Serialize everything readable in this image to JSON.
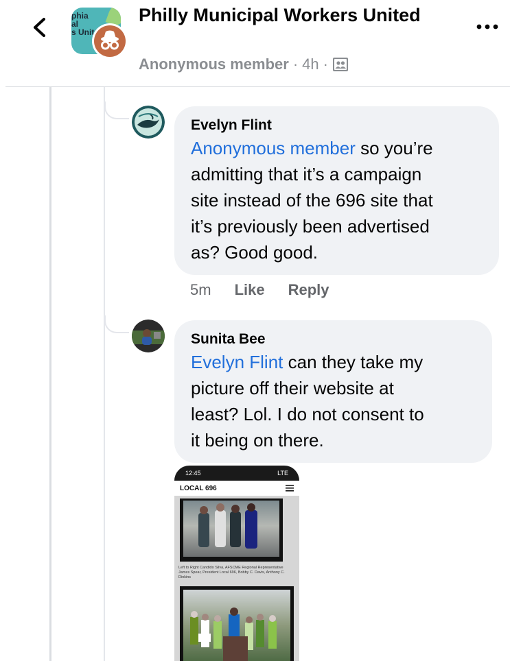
{
  "header": {
    "group_name": "Philly Municipal Workers United",
    "group_avatar_text": "phia\nal\ns Unit",
    "author_label": "Anonymous member",
    "separator": "·",
    "time": "4h",
    "audience_icon": "group-members-icon",
    "more_icon": "more-dots-icon",
    "back_icon": "back-chevron-icon"
  },
  "comments": [
    {
      "author": "Evelyn Flint",
      "mention": "Anonymous member",
      "lines": [
        " so you’re",
        "admitting that it’s a campaign",
        "site instead of the 696 site that",
        "it’s previously been advertised",
        "as? Good good."
      ],
      "time": "5m",
      "like_label": "Like",
      "reply_label": "Reply"
    },
    {
      "author": "Sunita Bee",
      "mention": "Evelyn Flint",
      "lines": [
        " can they take my",
        "picture off their website at",
        "least?  Lol.  I do not consent to",
        "it being on there."
      ]
    }
  ],
  "attachment": {
    "status_time": "12:45",
    "status_signal": "LTE",
    "site_title": "LOCAL 696",
    "caption": "Left to Right Candido Silva, AFSCME Regional Representative James Spear, President Local 696, Bobby C. Davis, Anthony C. Dinkins"
  },
  "colors": {
    "mention": "#216fdb",
    "bubble": "#f0f2f5",
    "meta_gray": "#8a8d91"
  }
}
